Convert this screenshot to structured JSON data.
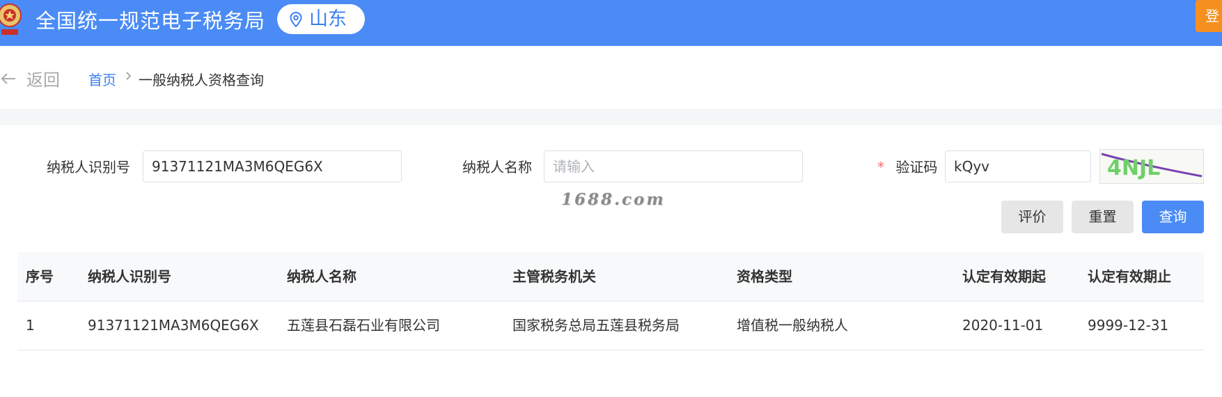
{
  "header": {
    "site_title": "全国统一规范电子税务局",
    "region": "山东",
    "login_label": "登"
  },
  "breadcrumb": {
    "back_label": "返回",
    "home": "首页",
    "current": "一般纳税人资格查询"
  },
  "form": {
    "taxpayer_id_label": "纳税人识别号",
    "taxpayer_id_value": "91371121MA3M6QEG6X",
    "taxpayer_name_label": "纳税人名称",
    "taxpayer_name_placeholder": "请输入",
    "captcha_required_mark": "*",
    "captcha_label": "验证码",
    "captcha_value": "kQyv",
    "captcha_image_text": "4NJL"
  },
  "watermark": "1688.com",
  "buttons": {
    "evaluate": "评价",
    "reset": "重置",
    "query": "查询"
  },
  "table": {
    "columns": [
      "序号",
      "纳税人识别号",
      "纳税人名称",
      "主管税务机关",
      "资格类型",
      "认定有效期起",
      "认定有效期止"
    ],
    "rows": [
      [
        "1",
        "91371121MA3M6QEG6X",
        "五莲县石磊石业有限公司",
        "国家税务总局五莲县税务局",
        "增值税一般纳税人",
        "2020-11-01",
        "9999-12-31"
      ]
    ]
  },
  "colors": {
    "header_bg": "#4a8bf5",
    "link_blue": "#3a7ff0",
    "login_orange": "#f5901e",
    "required_red": "#f56c6c"
  }
}
